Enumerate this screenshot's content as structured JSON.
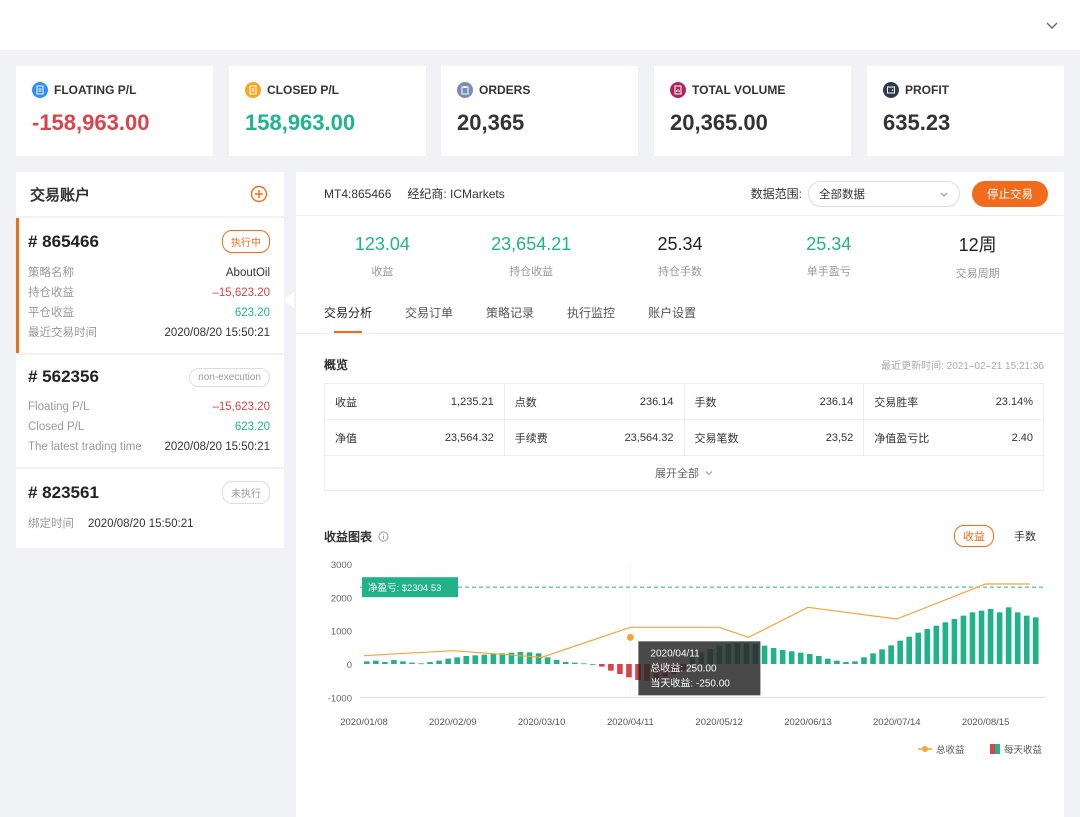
{
  "stats": [
    {
      "label": "FLOATING P/L",
      "value": "-158,963.00",
      "icon": "document-icon",
      "color": "#2f8ff5",
      "tone": "red"
    },
    {
      "label": "CLOSED P/L",
      "value": "158,963.00",
      "icon": "document-icon",
      "color": "#f5a623",
      "tone": "green"
    },
    {
      "label": "ORDERS",
      "value": "20,365",
      "icon": "clipboard-icon",
      "color": "#7a8db5",
      "tone": "normal"
    },
    {
      "label": "TOTAL VOLUME",
      "value": "20,365.00",
      "icon": "report-icon",
      "color": "#b0245e",
      "tone": "normal"
    },
    {
      "label": "PROFIT",
      "value": "635.23",
      "icon": "wallet-icon",
      "color": "#2e3b4e",
      "tone": "normal"
    }
  ],
  "accounts": {
    "title": "交易账户",
    "items": [
      {
        "number": "# 865466",
        "badge": "执行中",
        "rows": [
          [
            "策略名称",
            "AboutOil"
          ],
          [
            "持仓收益",
            "–15,623.20"
          ],
          [
            "平仓收益",
            "623.20"
          ],
          [
            "最近交易时间",
            "2020/08/20 15:50:21"
          ]
        ]
      },
      {
        "number": "# 562356",
        "badge": "non-execution",
        "rows": [
          [
            "Floating P/L",
            "–15,623.20"
          ],
          [
            "Closed P/L",
            "623.20"
          ],
          [
            "The latest trading time",
            "2020/08/20 15:50:21"
          ]
        ]
      },
      {
        "number": "# 823561",
        "badge": "未执行",
        "rows": [
          [
            "绑定时间",
            "2020/08/20 15:50:21"
          ]
        ]
      }
    ]
  },
  "main": {
    "account": "MT4:865466",
    "broker": "经纪商: ICMarkets",
    "range_label": "数据范围:",
    "range_value": "全部数据",
    "stop_button": "停止交易",
    "metrics": [
      {
        "value": "123.04",
        "label": "收益"
      },
      {
        "value": "23,654.21",
        "label": "持仓收益"
      },
      {
        "value": "25.34",
        "label": "持仓手数"
      },
      {
        "value": "25.34",
        "label": "单手盈亏"
      },
      {
        "value": "12周",
        "label": "交易周期"
      }
    ],
    "tabs": [
      "交易分析",
      "交易订单",
      "策略记录",
      "执行监控",
      "账户设置"
    ],
    "overview": {
      "title": "概览",
      "updated": "最近更新时间: 2021–02–21 15:21:36",
      "rows": [
        [
          [
            "收益",
            "1,235.21"
          ],
          [
            "点数",
            "236.14"
          ],
          [
            "手数",
            "236.14"
          ],
          [
            "交易胜率",
            "23.14%"
          ]
        ],
        [
          [
            "净值",
            "23,564.32"
          ],
          [
            "手续费",
            "23,564.32"
          ],
          [
            "交易笔数",
            "23,52"
          ],
          [
            "净值盈亏比",
            "2.40"
          ]
        ]
      ],
      "expand": "展开全部"
    },
    "chart_title": "收益图表",
    "toggle": [
      "收益",
      "手数"
    ]
  },
  "chart_data": {
    "type": "bar",
    "ylim": [
      -1000,
      3000
    ],
    "y_ticks": [
      "3000",
      "2000",
      "1000",
      "0",
      "-1000"
    ],
    "x_ticks": [
      "2020/01/08",
      "2020/02/09",
      "2020/03/10",
      "2020/04/11",
      "2020/05/12",
      "2020/06/13",
      "2020/07/14",
      "2020/08/15"
    ],
    "reference_label": "净盈亏: $2304.53",
    "reference_value": 2304.53,
    "tooltip": {
      "date": "2020/04/11",
      "total": "总收益: 250.00",
      "daily": "当天收益: -250.00"
    },
    "legend": [
      "总收益",
      "每天收益"
    ],
    "series": [
      {
        "name": "总收益",
        "type": "line",
        "color": "#f0a63c",
        "points": [
          [
            0,
            250
          ],
          [
            1,
            400
          ],
          [
            2,
            200
          ],
          [
            3,
            1100
          ],
          [
            4,
            1100
          ],
          [
            4.33,
            800
          ],
          [
            5,
            1700
          ],
          [
            6,
            1350
          ],
          [
            7,
            2400
          ],
          [
            7.5,
            2400
          ]
        ]
      },
      {
        "name": "每天收益",
        "type": "bar",
        "pos_color": "#21b28a",
        "neg_color": "#d9434b",
        "values": [
          80,
          100,
          60,
          120,
          80,
          40,
          20,
          60,
          100,
          160,
          200,
          240,
          260,
          280,
          300,
          320,
          340,
          360,
          350,
          320,
          200,
          120,
          60,
          40,
          20,
          0,
          -80,
          -200,
          -300,
          -400,
          -480,
          -500,
          -450,
          -400,
          -300,
          -200,
          200,
          350,
          450,
          550,
          600,
          620,
          620,
          600,
          550,
          480,
          420,
          380,
          340,
          300,
          240,
          160,
          100,
          60,
          80,
          200,
          320,
          440,
          560,
          700,
          820,
          940,
          1050,
          1150,
          1250,
          1350,
          1450,
          1550,
          1600,
          1650,
          1550,
          1700,
          1550,
          1450,
          1400
        ]
      }
    ]
  }
}
